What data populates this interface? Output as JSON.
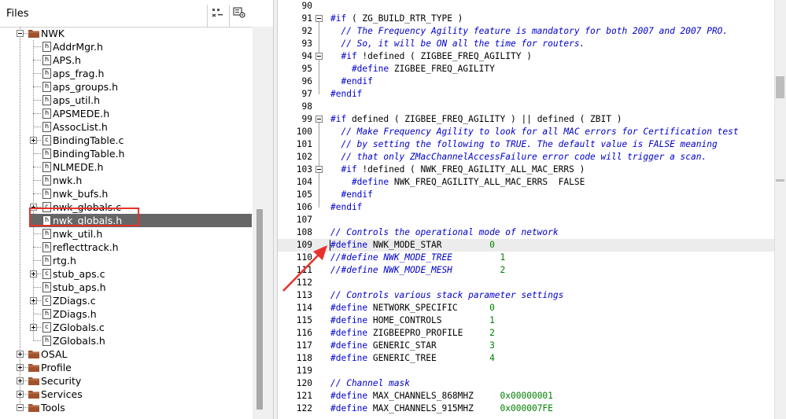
{
  "files_panel": {
    "title": "Files",
    "header_icons": [
      "collapse-all-icon",
      "settings-icon"
    ],
    "tree": [
      {
        "label": "NWK",
        "type": "folder",
        "level": 0,
        "expander": "minus"
      },
      {
        "label": "AddrMgr.h",
        "type": "h",
        "level": 1
      },
      {
        "label": "APS.h",
        "type": "h",
        "level": 1
      },
      {
        "label": "aps_frag.h",
        "type": "h",
        "level": 1
      },
      {
        "label": "aps_groups.h",
        "type": "h",
        "level": 1
      },
      {
        "label": "aps_util.h",
        "type": "h",
        "level": 1
      },
      {
        "label": "APSMEDE.h",
        "type": "h",
        "level": 1
      },
      {
        "label": "AssocList.h",
        "type": "h",
        "level": 1
      },
      {
        "label": "BindingTable.c",
        "type": "c",
        "level": 1,
        "expander": "plus"
      },
      {
        "label": "BindingTable.h",
        "type": "h",
        "level": 1
      },
      {
        "label": "NLMEDE.h",
        "type": "h",
        "level": 1
      },
      {
        "label": "nwk.h",
        "type": "h",
        "level": 1
      },
      {
        "label": "nwk_bufs.h",
        "type": "h",
        "level": 1
      },
      {
        "label": "nwk_globals.c",
        "type": "c",
        "level": 1,
        "expander": "plus"
      },
      {
        "label": "nwk_globals.h",
        "type": "h",
        "level": 1,
        "selected": true
      },
      {
        "label": "nwk_util.h",
        "type": "h",
        "level": 1
      },
      {
        "label": "reflecttrack.h",
        "type": "h",
        "level": 1
      },
      {
        "label": "rtg.h",
        "type": "h",
        "level": 1
      },
      {
        "label": "stub_aps.c",
        "type": "c",
        "level": 1,
        "expander": "plus"
      },
      {
        "label": "stub_aps.h",
        "type": "h",
        "level": 1
      },
      {
        "label": "ZDiags.c",
        "type": "c",
        "level": 1,
        "expander": "plus"
      },
      {
        "label": "ZDiags.h",
        "type": "h",
        "level": 1
      },
      {
        "label": "ZGlobals.c",
        "type": "c",
        "level": 1,
        "expander": "plus"
      },
      {
        "label": "ZGlobals.h",
        "type": "h",
        "level": 1
      },
      {
        "label": "OSAL",
        "type": "folder",
        "level": 0,
        "expander": "plus"
      },
      {
        "label": "Profile",
        "type": "folder",
        "level": 0,
        "expander": "plus"
      },
      {
        "label": "Security",
        "type": "folder",
        "level": 0,
        "expander": "plus"
      },
      {
        "label": "Services",
        "type": "folder",
        "level": 0,
        "expander": "plus"
      },
      {
        "label": "Tools",
        "type": "folder",
        "level": 0,
        "expander": "minus"
      }
    ],
    "file_icon_letters": {
      "h": "h",
      "c": "c"
    }
  },
  "editor": {
    "current_line": 109,
    "lines": [
      {
        "n": "90",
        "t": []
      },
      {
        "n": "91",
        "fold": "start",
        "t": [
          [
            "kw",
            "#if"
          ],
          [
            "tx",
            " ( ZG_BUILD_RTR_TYPE )"
          ]
        ]
      },
      {
        "n": "92",
        "t": [
          [
            "cm",
            "  // The Frequency Agility feature is mandatory for both 2007 and 2007 PRO."
          ]
        ]
      },
      {
        "n": "93",
        "t": [
          [
            "cm",
            "  // So, it will be ON all the time for routers."
          ]
        ]
      },
      {
        "n": "94",
        "fold": "start",
        "t": [
          [
            "kw",
            "  #if"
          ],
          [
            "tx",
            " !defined ( ZIGBEE_FREQ_AGILITY )"
          ]
        ]
      },
      {
        "n": "95",
        "t": [
          [
            "kw",
            "    #define"
          ],
          [
            "tx",
            " ZIGBEE_FREQ_AGILITY"
          ]
        ]
      },
      {
        "n": "96",
        "t": [
          [
            "kw",
            "  #endif"
          ]
        ]
      },
      {
        "n": "97",
        "t": [
          [
            "kw",
            "#endif"
          ]
        ]
      },
      {
        "n": "98",
        "t": []
      },
      {
        "n": "99",
        "fold": "start",
        "t": [
          [
            "kw",
            "#if"
          ],
          [
            "tx",
            " defined ( ZIGBEE_FREQ_AGILITY ) || defined ( ZBIT )"
          ]
        ]
      },
      {
        "n": "100",
        "t": [
          [
            "cm",
            "  // Make Frequency Agility to look for all MAC errors for Certification test"
          ]
        ]
      },
      {
        "n": "101",
        "t": [
          [
            "cm",
            "  // by setting the following to TRUE. The default value is FALSE meaning"
          ]
        ]
      },
      {
        "n": "102",
        "t": [
          [
            "cm",
            "  // that only ZMacChannelAccessFailure error code will trigger a scan."
          ]
        ]
      },
      {
        "n": "103",
        "fold": "start",
        "t": [
          [
            "kw",
            "  #if"
          ],
          [
            "tx",
            " !defined ( NWK_FREQ_AGILITY_ALL_MAC_ERRS )"
          ]
        ]
      },
      {
        "n": "104",
        "t": [
          [
            "kw",
            "    #define"
          ],
          [
            "tx",
            " NWK_FREQ_AGILITY_ALL_MAC_ERRS  FALSE"
          ]
        ]
      },
      {
        "n": "105",
        "t": [
          [
            "kw",
            "  #endif"
          ]
        ]
      },
      {
        "n": "106",
        "t": [
          [
            "kw",
            "#endif"
          ]
        ]
      },
      {
        "n": "107",
        "t": []
      },
      {
        "n": "108",
        "t": [
          [
            "cm",
            "// Controls the operational mode of network"
          ]
        ]
      },
      {
        "n": "109",
        "t": [
          [
            "kw",
            "#define"
          ],
          [
            "tx",
            " NWK_MODE_STAR         "
          ],
          [
            "nm",
            "0"
          ]
        ]
      },
      {
        "n": "110",
        "t": [
          [
            "cm",
            "//#define NWK_MODE_TREE         "
          ],
          [
            "nm",
            "1"
          ]
        ]
      },
      {
        "n": "111",
        "t": [
          [
            "cm",
            "//#define NWK_MODE_MESH         "
          ],
          [
            "nm",
            "2"
          ]
        ]
      },
      {
        "n": "112",
        "t": []
      },
      {
        "n": "113",
        "t": [
          [
            "cm",
            "// Controls various stack parameter settings"
          ]
        ]
      },
      {
        "n": "114",
        "t": [
          [
            "kw",
            "#define"
          ],
          [
            "tx",
            " NETWORK_SPECIFIC      "
          ],
          [
            "nm",
            "0"
          ]
        ]
      },
      {
        "n": "115",
        "t": [
          [
            "kw",
            "#define"
          ],
          [
            "tx",
            " HOME_CONTROLS         "
          ],
          [
            "nm",
            "1"
          ]
        ]
      },
      {
        "n": "116",
        "t": [
          [
            "kw",
            "#define"
          ],
          [
            "tx",
            " ZIGBEEPRO_PROFILE     "
          ],
          [
            "nm",
            "2"
          ]
        ]
      },
      {
        "n": "117",
        "t": [
          [
            "kw",
            "#define"
          ],
          [
            "tx",
            " GENERIC_STAR          "
          ],
          [
            "nm",
            "3"
          ]
        ]
      },
      {
        "n": "118",
        "t": [
          [
            "kw",
            "#define"
          ],
          [
            "tx",
            " GENERIC_TREE          "
          ],
          [
            "nm",
            "4"
          ]
        ]
      },
      {
        "n": "119",
        "t": []
      },
      {
        "n": "120",
        "t": [
          [
            "cm",
            "// Channel mask"
          ]
        ]
      },
      {
        "n": "121",
        "t": [
          [
            "kw",
            "#define"
          ],
          [
            "tx",
            " MAX_CHANNELS_868MHZ     "
          ],
          [
            "nm",
            "0x00000001"
          ]
        ]
      },
      {
        "n": "122",
        "t": [
          [
            "kw",
            "#define"
          ],
          [
            "tx",
            " MAX_CHANNELS_915MHZ     "
          ],
          [
            "nm",
            "0x000007FE"
          ]
        ]
      }
    ]
  },
  "annotation": {
    "color": "#e8312d"
  }
}
